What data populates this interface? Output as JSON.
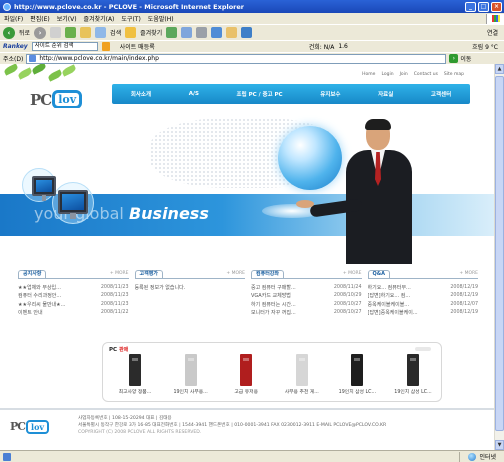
{
  "window": {
    "title": "http://www.pclove.co.kr - PCLOVE - Microsoft Internet Explorer",
    "buttons": {
      "minimize": "_",
      "maximize": "□",
      "close": "×"
    }
  },
  "menu": [
    "파일(F)",
    "편집(E)",
    "보기(V)",
    "즐겨찾기(A)",
    "도구(T)",
    "도움말(H)"
  ],
  "toolbar": {
    "back": "뒤로",
    "search": "검색",
    "favorites": "즐겨찾기",
    "links": "연결"
  },
  "rankbar": {
    "logo": "Rankey",
    "search_value": "사이트 순위 검색",
    "site_label": "사이트 매등록",
    "stat_label": "건희: N/A",
    "num1": "1.6",
    "weather": "흐림 9 °C"
  },
  "address": {
    "label": "주소(D)",
    "url": "http://www.pclove.co.kr/main/index.php",
    "go": "이동"
  },
  "site": {
    "util_nav": [
      "Home",
      "Login",
      "Join",
      "Contact us",
      "Site map"
    ],
    "logo": {
      "pc": "PC",
      "love": "lov"
    },
    "main_nav": [
      "회사소개",
      "A/S",
      "조립 PC / 중고 PC",
      "유지보수",
      "자료실",
      "고객센터"
    ],
    "slogan": {
      "light": "your global ",
      "bold": "Business"
    },
    "boards": [
      {
        "title": "공지사항",
        "more": "MORE",
        "rows": [
          {
            "text": "★★업체와 무상입...",
            "date": "2008/11/23"
          },
          {
            "text": "컴퓨터 수리과정안...",
            "date": "2008/11/23"
          },
          {
            "text": "★★우리씨 물만내★...",
            "date": "2008/11/23"
          },
          {
            "text": "이벤트 안내",
            "date": "2008/11/22"
          }
        ]
      },
      {
        "title": "고객평가",
        "more": "MORE",
        "rows": [
          {
            "text": "등록된 정보가 없습니다.",
            "date": ""
          }
        ]
      },
      {
        "title": "컴퓨터강좌",
        "more": "MORE",
        "rows": [
          {
            "text": "중고 컴퓨터 구매할...",
            "date": "2008/11/24"
          },
          {
            "text": "VGA카드 교체방법",
            "date": "2008/10/29"
          },
          {
            "text": "하기 컴퓨터는 시간...",
            "date": "2008/10/27"
          },
          {
            "text": "모니터가 자꾸 꺼집...",
            "date": "2008/10/27"
          }
        ]
      },
      {
        "title": "Q&A",
        "more": "MORE",
        "rows": [
          {
            "text": "하기요... 컴퓨터무...",
            "date": "2008/12/19"
          },
          {
            "text": "[답변]하기요... 컴...",
            "date": "2008/12/19"
          },
          {
            "text": "중옥케이블케이블...",
            "date": "2008/12/07"
          },
          {
            "text": "[답변]중옥케이블케이...",
            "date": "2008/12/19"
          }
        ]
      }
    ],
    "pc_section": {
      "title": "PC",
      "subtitle": "판매",
      "products": [
        {
          "label": "최고사양 정품...",
          "color": "#2b2b2b"
        },
        {
          "label": "19인치 사무용...",
          "color": "#c9c9c9"
        },
        {
          "label": "고급 유저용",
          "color": "#b01e1e"
        },
        {
          "label": "사무용 추천 게...",
          "color": "#d6d6d6"
        },
        {
          "label": "19인치 삼성 LC...",
          "color": "#1e1e1e"
        },
        {
          "label": "19인치 삼성 LC...",
          "color": "#2a2a2a"
        }
      ]
    },
    "footer": {
      "logo": {
        "pc": "PC",
        "love": "lov"
      },
      "line1": "사업자등록번호 | 108-15-20294     대표 | 김태용",
      "line2": "서울특별시 동작구 한강로 3가 16-85     대표전화번호 | 1544-3941     핸드폰번호 | 010-0001-3941     FAX 0230012-3911     E-MAIL PCLOVE@PCLOV.CO.KR",
      "line3": "COPYRIGHT (C) 2008 PCLOVE ALL RIGHTS RESERVED."
    }
  },
  "status": {
    "text": "",
    "zone": "인터넷"
  }
}
